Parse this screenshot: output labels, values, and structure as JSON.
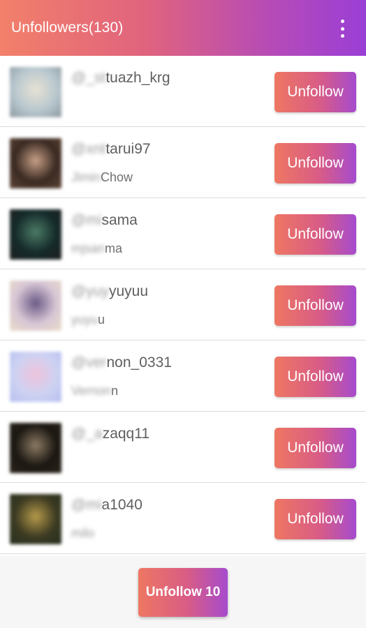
{
  "appbar": {
    "title": "Unfollowers(130)",
    "menu_icon": "more-vert-icon",
    "gradient_start": "#f2806a",
    "gradient_end": "#9a3fd6"
  },
  "users": [
    {
      "handle_masked": "@_st",
      "handle_visible": "tuazh_krg",
      "name_masked": "",
      "name_visible": "",
      "avatar_colors": [
        "#b9c8cf",
        "#e7e2d4",
        "#8d99a0"
      ]
    },
    {
      "handle_masked": "@xnt",
      "handle_visible": "tarui97",
      "name_masked": "Jimin",
      "name_visible": "Chow",
      "avatar_colors": [
        "#3a2a22",
        "#c79f86",
        "#5e4436"
      ]
    },
    {
      "handle_masked": "@mi",
      "handle_visible": "sama",
      "name_masked": "mjsan",
      "name_visible": "ma",
      "avatar_colors": [
        "#152a2a",
        "#4b7b65",
        "#1e1e1e"
      ]
    },
    {
      "handle_masked": "@yuy",
      "handle_visible": "yuyuu",
      "name_masked": "yuyu",
      "name_visible": "u",
      "avatar_colors": [
        "#d8c7d5",
        "#6c5b86",
        "#e9dcc9"
      ]
    },
    {
      "handle_masked": "@ver",
      "handle_visible": "non_0331",
      "name_masked": "Vernon",
      "name_visible": "n",
      "avatar_colors": [
        "#cdd2f2",
        "#efc3dc",
        "#b6bff0"
      ]
    },
    {
      "handle_masked": "@_a",
      "handle_visible": "zaqq11",
      "name_masked": "",
      "name_visible": "",
      "avatar_colors": [
        "#1b1712",
        "#8b7a63",
        "#2a2319"
      ]
    },
    {
      "handle_masked": "@mi",
      "handle_visible": "a1040",
      "name_masked": "milo",
      "name_visible": "",
      "avatar_colors": [
        "#3c3a22",
        "#b59a4a",
        "#24301f"
      ]
    }
  ],
  "row_button_label": "Unfollow",
  "footer": {
    "bulk_button_label": "Unfollow 10"
  }
}
